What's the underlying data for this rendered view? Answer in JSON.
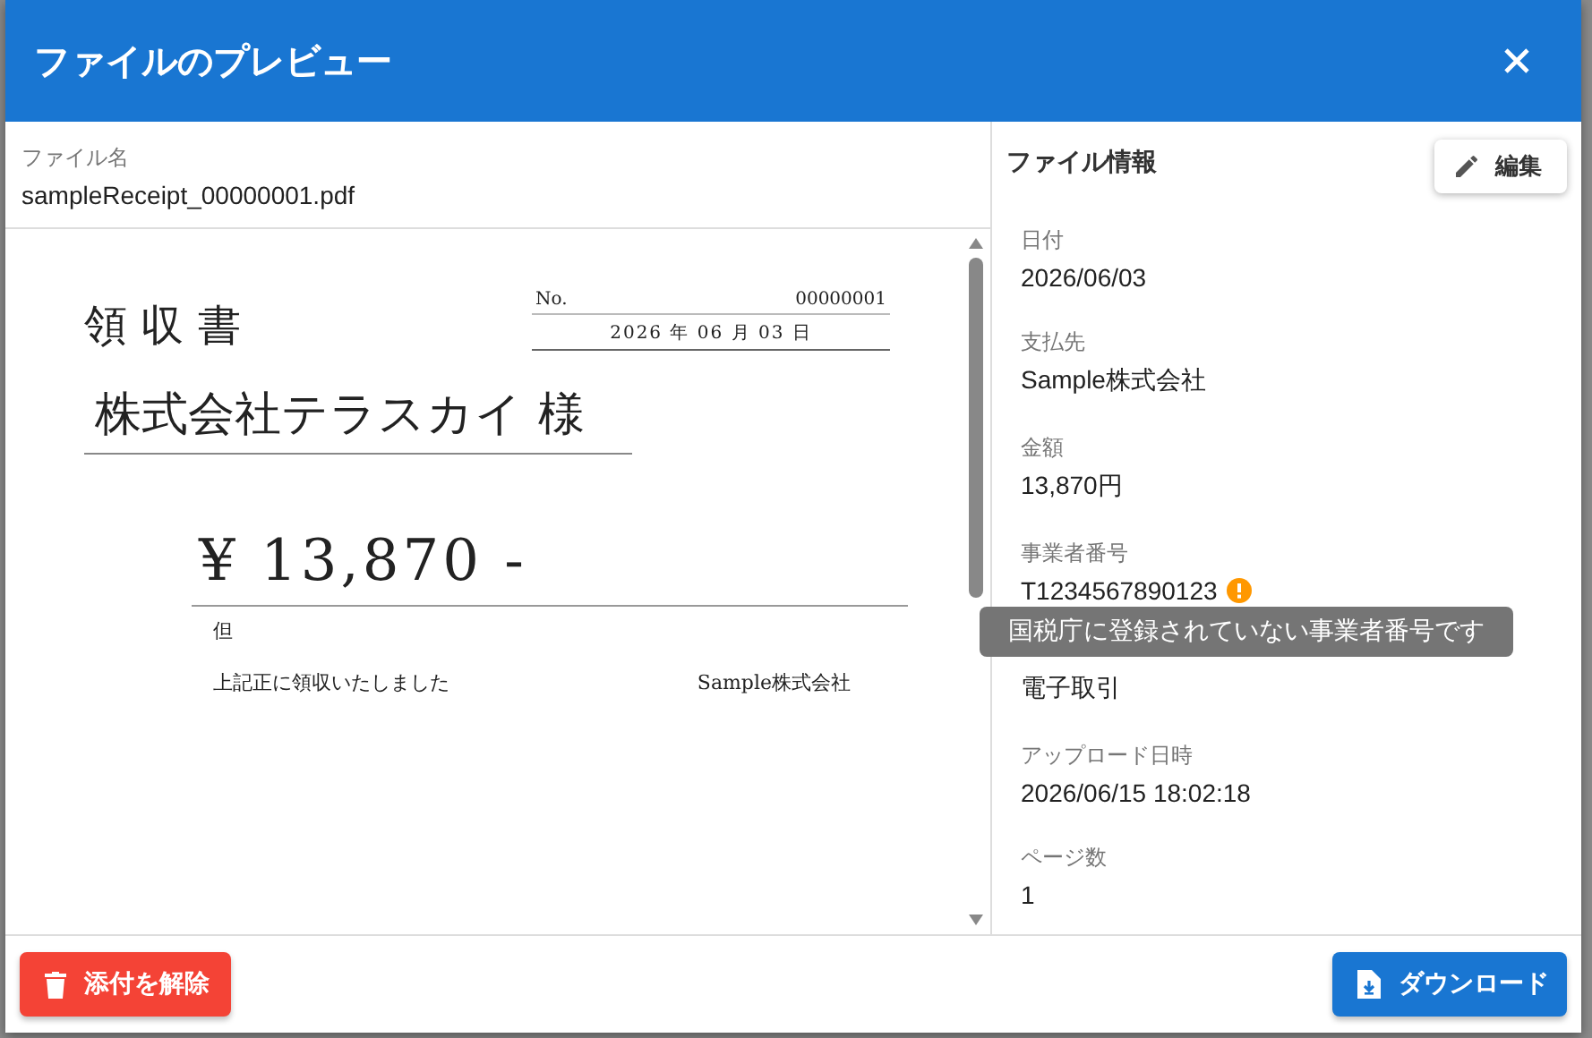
{
  "dialog": {
    "title": "ファイルのプレビュー"
  },
  "file": {
    "label": "ファイル名",
    "value": "sampleReceipt_00000001.pdf"
  },
  "receipt": {
    "title": "領 収 書",
    "no_label": "No.",
    "no": "00000001",
    "date": "2026 年 06 月 03 日",
    "recipient": "株式会社テラスカイ 様",
    "amount": "¥ 13,870 -",
    "proviso": "但",
    "note": "上記正に領収いたしました",
    "issuer": "Sample株式会社"
  },
  "info": {
    "title": "ファイル情報",
    "edit_button": "編集",
    "fields": [
      {
        "label": "日付",
        "value": "2026/06/03",
        "warning": false
      },
      {
        "label": "支払先",
        "value": "Sample株式会社",
        "warning": false
      },
      {
        "label": "金額",
        "value": "13,870円",
        "warning": false
      },
      {
        "label": "事業者番号",
        "value": "T1234567890123",
        "warning": true,
        "tooltip": "国税庁に登録されていない事業者番号です"
      },
      {
        "value": "電子取引",
        "warning": false
      },
      {
        "label": "アップロード日時",
        "value": "2026/06/15 18:02:18",
        "warning": false
      },
      {
        "label": "ページ数",
        "value": "1",
        "warning": false
      }
    ]
  },
  "buttons": {
    "detach": "添付を解除",
    "download": "ダウンロード"
  }
}
